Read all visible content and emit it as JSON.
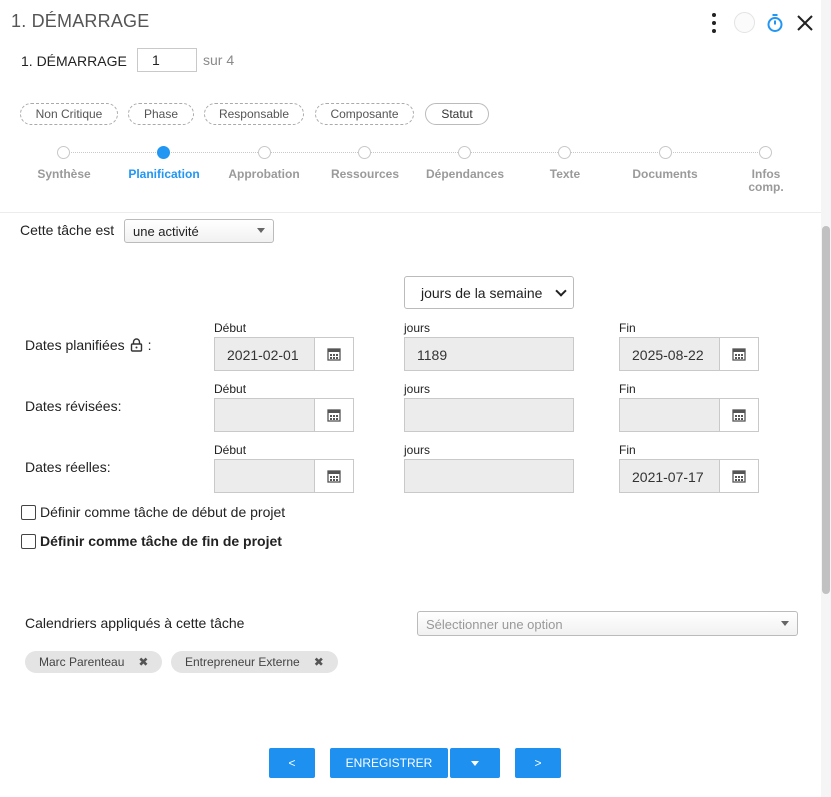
{
  "header": {
    "title": "1. DÉMARRAGE",
    "phase_label": "1. DÉMARRAGE",
    "phase_value": "1",
    "phase_of": "sur 4"
  },
  "chips": [
    "Non Critique",
    "Phase",
    "Responsable",
    "Composante",
    "Statut"
  ],
  "steps": [
    {
      "label": "Synthèse"
    },
    {
      "label": "Planification"
    },
    {
      "label": "Approbation"
    },
    {
      "label": "Ressources"
    },
    {
      "label": "Dépendances"
    },
    {
      "label": "Texte"
    },
    {
      "label": "Documents"
    },
    {
      "label": "Infos comp."
    }
  ],
  "active_step": 1,
  "form": {
    "task_type_label": "Cette tâche est",
    "task_type_value": "une activité",
    "day_mode": "jours de la semaine",
    "col_start": "Début",
    "col_days": "jours",
    "col_end": "Fin",
    "rows": [
      {
        "label": "Dates planifiées",
        "suffix": ":",
        "start": "2021-02-01",
        "days": "1189",
        "end": "2025-08-22"
      },
      {
        "label": "Dates révisées:",
        "start": "",
        "days": "",
        "end": ""
      },
      {
        "label": "Dates réelles:",
        "start": "",
        "days": "",
        "end": "2021-07-17"
      }
    ],
    "chk_start_label": "Définir comme tâche de début de projet",
    "chk_end_label": "Définir comme tâche de fin de projet",
    "calendars_label": "Calendriers appliqués à cette tâche",
    "calendars_placeholder": "Sélectionner une option",
    "tags": [
      "Marc Parenteau",
      "Entrepreneur Externe"
    ]
  },
  "footer": {
    "prev": "<",
    "save": "ENREGISTRER",
    "next": ">"
  },
  "colors": {
    "accent": "#1e90f0",
    "step_active": "#2196f3",
    "field_bg": "#ececec"
  },
  "icons": [
    "kebab-menu-icon",
    "timer-icon",
    "close-icon",
    "lock-icon",
    "calendar-icon",
    "remove-x-icon",
    "caret-down-icon"
  ]
}
